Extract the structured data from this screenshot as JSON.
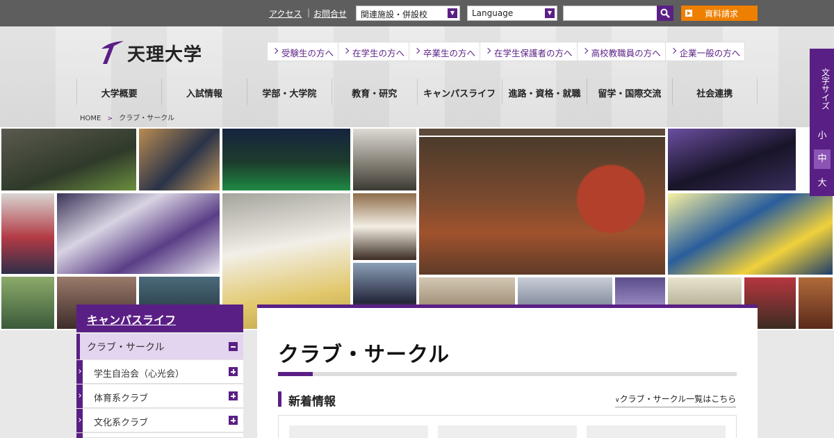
{
  "utility": {
    "access": "アクセス",
    "contact": "お問合せ",
    "separator": "|",
    "affiliates_select": "関連施設・併設校",
    "language_select": "Language",
    "search_placeholder": "",
    "request_label": "資料請求"
  },
  "header": {
    "logo_text": "天理大学",
    "audience": [
      "受験生の方へ",
      "在学生の方へ",
      "卒業生の方へ",
      "在学生保護者の方へ",
      "高校教職員の方へ",
      "企業一般の方へ"
    ],
    "nav": [
      "大学概要",
      "入試情報",
      "学部・大学院",
      "教育・研究",
      "キャンパスライフ",
      "進路・資格・就職",
      "留学・国際交流",
      "社会連携"
    ]
  },
  "breadcrumb": {
    "home": "HOME",
    "sep": ">",
    "current": "クラブ・サークル"
  },
  "fontsize": {
    "label": "文字サイズ",
    "small": "小",
    "medium": "中",
    "large": "大",
    "active": "中"
  },
  "sidebar": {
    "heading": "キャンパスライフ",
    "active_item": "クラブ・サークル",
    "items": [
      "学生自治会（心光会）",
      "体育系クラブ",
      "文化系クラブ"
    ]
  },
  "main": {
    "title": "クラブ・サークル",
    "news_heading": "新着情報",
    "list_link": "クラブ・サークル一覧はこちら"
  },
  "colors": {
    "brand_purple": "#5a1f85",
    "accent_orange": "#ee7f00",
    "topbar": "#5e5e5e"
  }
}
